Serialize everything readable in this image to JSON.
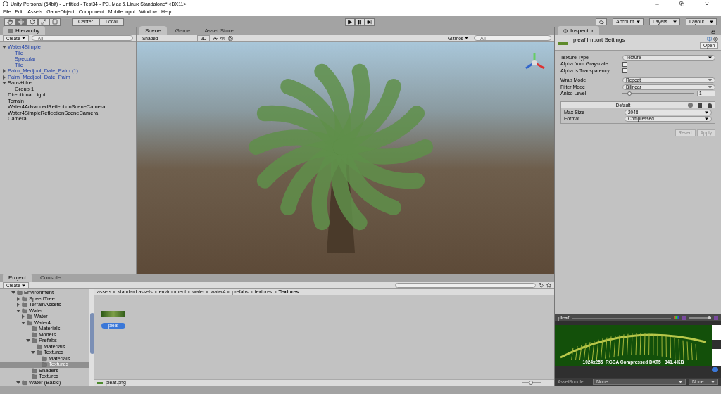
{
  "window": {
    "title": "Unity Personal (64bit) - Untitled - Test34 - PC, Mac & Linux Standalone* <DX11>"
  },
  "menu": [
    "File",
    "Edit",
    "Assets",
    "GameObject",
    "Component",
    "Mobile Input",
    "Window",
    "Help"
  ],
  "toolbar": {
    "tools": [
      {
        "kind": "hand",
        "selected": false
      },
      {
        "kind": "move",
        "selected": true
      },
      {
        "kind": "rotate",
        "selected": false
      },
      {
        "kind": "scale",
        "selected": false
      },
      {
        "kind": "rect",
        "selected": false
      }
    ],
    "pivot": [
      "Center",
      "Local"
    ],
    "play": [
      {
        "kind": "play",
        "selected": false
      },
      {
        "kind": "pause",
        "selected": false
      },
      {
        "kind": "step",
        "selected": false
      }
    ],
    "dropdowns": [
      "Account",
      "Layers",
      "Layout"
    ]
  },
  "hierarchy": {
    "tab": "Hierarchy",
    "create": "Create",
    "search_placeholder": "All",
    "items": [
      {
        "label": "Water4Simple",
        "kind": "prefab",
        "expanded": true,
        "children": [
          {
            "label": "Tile",
            "kind": "prefab"
          },
          {
            "label": "Specular",
            "kind": "prefab"
          },
          {
            "label": "Tile",
            "kind": "prefab"
          }
        ]
      },
      {
        "label": "Palm_Medjool_Date_Palm (1)",
        "kind": "prefab",
        "expanded": false
      },
      {
        "label": "Palm_Medjool_Date_Palm",
        "kind": "prefab",
        "expanded": false
      },
      {
        "label": "Sans+titre",
        "kind": "object",
        "expanded": true,
        "children": [
          {
            "label": "Group 1",
            "kind": "object"
          }
        ]
      },
      {
        "label": "Directional Light",
        "kind": "object"
      },
      {
        "label": "Terrain",
        "kind": "object"
      },
      {
        "label": "Water4AdvancedReflectionSceneCamera",
        "kind": "object"
      },
      {
        "label": "Water4SimpleReflectionSceneCamera",
        "kind": "object"
      },
      {
        "label": "Camera",
        "kind": "object"
      }
    ]
  },
  "scene": {
    "tabs": [
      {
        "label": "Scene",
        "selected": true
      },
      {
        "label": "Game",
        "selected": false
      },
      {
        "label": "Asset Store",
        "selected": false
      }
    ],
    "shading": "Shaded",
    "mode_2d": "2D",
    "gizmos": "Gizmos",
    "search_placeholder": "All"
  },
  "inspector": {
    "tab": "Inspector",
    "title": "pleaf Import Settings",
    "open": "Open",
    "fields": [
      {
        "kind": "select",
        "label": "Texture Type",
        "value": "Texture"
      },
      {
        "kind": "checkbox",
        "label": "Alpha from Grayscale",
        "checked": false
      },
      {
        "kind": "checkbox",
        "label": "Alpha Is Transparency",
        "checked": false
      },
      {
        "kind": "gap"
      },
      {
        "kind": "select",
        "label": "Wrap Mode",
        "value": "Repeat"
      },
      {
        "kind": "select",
        "label": "Filter Mode",
        "value": "Bilinear"
      },
      {
        "kind": "slider",
        "label": "Aniso Level",
        "level": 0.1,
        "value": "1"
      }
    ],
    "platform": {
      "title": "Default",
      "fields": [
        {
          "label": "Max Size",
          "value": "2048"
        },
        {
          "label": "Format",
          "value": "Compressed"
        }
      ]
    },
    "buttons": [
      {
        "label": "Revert",
        "disabled": true
      },
      {
        "label": "Apply",
        "disabled": true
      }
    ]
  },
  "preview": {
    "title": "pleaf",
    "mip": {
      "level": 1
    },
    "info": "1024x256  RGBA Compressed DXT5   341.4 KB",
    "bundle_label": "AssetBundle",
    "bundle_values": [
      "None",
      "None"
    ]
  },
  "project": {
    "tabs": [
      {
        "label": "Project",
        "selected": true
      },
      {
        "label": "Console",
        "selected": false
      }
    ],
    "create": "Create",
    "tree": [
      {
        "label": "Environment",
        "expanded": true,
        "selected": false,
        "children": [
          {
            "label": "SpeedTree",
            "expanded": false,
            "selected": false
          },
          {
            "label": "TerrainAssets",
            "expanded": false,
            "selected": false
          },
          {
            "label": "Water",
            "expanded": true,
            "selected": false,
            "children": [
              {
                "label": "Water",
                "expanded": false,
                "selected": false
              },
              {
                "label": "Water4",
                "expanded": true,
                "selected": false,
                "children": [
                  {
                    "label": "Materials",
                    "selected": false
                  },
                  {
                    "label": "Models",
                    "selected": false
                  },
                  {
                    "label": "Prefabs",
                    "expanded": true,
                    "selected": false,
                    "children": [
                      {
                        "label": "Materials",
                        "selected": false
                      },
                      {
                        "label": "Textures",
                        "expanded": true,
                        "selected": false,
                        "children": [
                          {
                            "label": "Materials",
                            "selected": false
                          },
                          {
                            "label": "Textures",
                            "selected": true
                          }
                        ]
                      }
                    ]
                  },
                  {
                    "label": "Shaders",
                    "selected": false
                  },
                  {
                    "label": "Textures",
                    "selected": false
                  }
                ]
              }
            ]
          },
          {
            "label": "Water (Basic)",
            "expanded": true,
            "selected": false
          }
        ]
      }
    ],
    "breadcrumb": [
      "assets",
      "standard assets",
      "environment",
      "water",
      "water4",
      "prefabs",
      "textures",
      "Textures"
    ],
    "assets": [
      {
        "label": "pleaf",
        "selected": true
      }
    ],
    "footer": "pleaf.png",
    "zoom": {
      "level": 0.45
    }
  }
}
